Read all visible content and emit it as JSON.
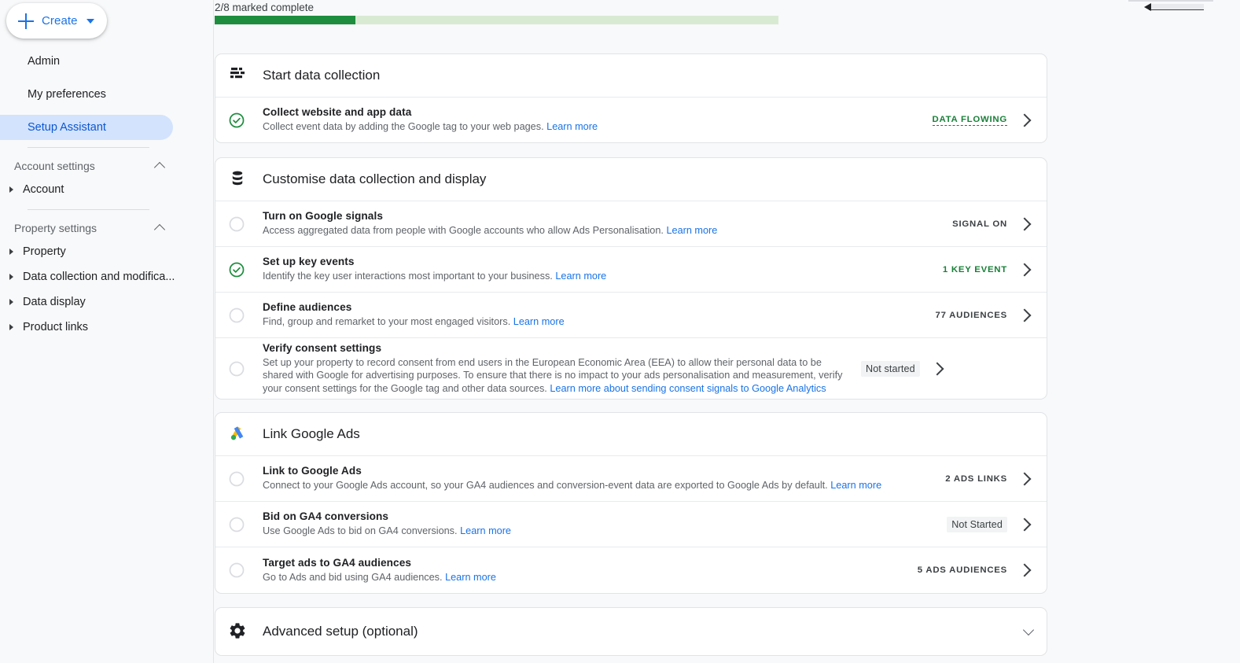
{
  "sidebar": {
    "create_button": {
      "label": "Create",
      "icon": "plus-icon",
      "caret": "chevron-down-icon"
    },
    "nav": [
      {
        "label": "Admin",
        "selected": false
      },
      {
        "label": "My preferences",
        "selected": false
      },
      {
        "label": "Setup Assistant",
        "selected": true
      }
    ],
    "groups": [
      {
        "label": "Account settings",
        "expanded": true,
        "items": [
          {
            "label": "Account"
          }
        ]
      },
      {
        "label": "Property settings",
        "expanded": true,
        "items": [
          {
            "label": "Property"
          },
          {
            "label": "Data collection and modifica..."
          },
          {
            "label": "Data display"
          },
          {
            "label": "Product links"
          }
        ]
      }
    ]
  },
  "progress": {
    "label": "2/8 marked complete",
    "completed": 2,
    "total": 8,
    "percent": 25,
    "fill_color": "#1e8e3e",
    "track_color": "#d9ead3"
  },
  "cards": [
    {
      "title": "Start data collection",
      "icon": "data-collection-icon",
      "rows": [
        {
          "status": "complete",
          "title": "Collect website and app data",
          "desc": "Collect event data by adding the Google tag to your web pages.",
          "link": "Learn more",
          "status_text": "DATA FLOWING",
          "status_style": "green"
        }
      ]
    },
    {
      "title": "Customise data collection and display",
      "icon": "database-icon",
      "rows": [
        {
          "status": "incomplete",
          "title": "Turn on Google signals",
          "desc": "Access aggregated data from people with Google accounts who allow Ads Personalisation.",
          "link": "Learn more",
          "status_text": "SIGNAL ON",
          "status_style": "grey"
        },
        {
          "status": "complete",
          "title": "Set up key events",
          "desc": "Identify the key user interactions most important to your business.",
          "link": "Learn more",
          "status_text": "1 KEY EVENT",
          "status_style": "green-plain"
        },
        {
          "status": "incomplete",
          "title": "Define audiences",
          "desc": "Find, group and remarket to your most engaged visitors.",
          "link": "Learn more",
          "status_text": "77 AUDIENCES",
          "status_style": "grey"
        },
        {
          "status": "incomplete",
          "title": "Verify consent settings",
          "desc": "Set up your property to record consent from end users in the European Economic Area (EEA) to allow their personal data to be shared with Google for advertising purposes. To ensure that there is no impact to your ads personalisation and measurement, verify your consent settings for the Google tag and other data sources.",
          "link": "Learn more about sending consent signals to Google Analytics",
          "status_text": "Not started",
          "status_style": "chip"
        }
      ]
    },
    {
      "title": "Link Google Ads",
      "icon": "google-ads-icon",
      "rows": [
        {
          "status": "incomplete",
          "title": "Link to Google Ads",
          "desc": "Connect to your Google Ads account, so your GA4 audiences and conversion-event data are exported to Google Ads by default.",
          "link": "Learn more",
          "status_text": "2 ADS LINKS",
          "status_style": "grey"
        },
        {
          "status": "incomplete",
          "title": "Bid on GA4 conversions",
          "desc": "Use Google Ads to bid on GA4 conversions.",
          "link": "Learn more",
          "status_text": "Not Started",
          "status_style": "chip"
        },
        {
          "status": "incomplete",
          "title": "Target ads to GA4 audiences",
          "desc": "Go to Ads and bid using GA4 audiences.",
          "link": "Learn more",
          "status_text": "5 ADS AUDIENCES",
          "status_style": "grey"
        }
      ]
    }
  ],
  "advanced": {
    "title": "Advanced setup (optional)",
    "icon": "gear-icon",
    "expand_icon": "chevron-down-icon"
  }
}
